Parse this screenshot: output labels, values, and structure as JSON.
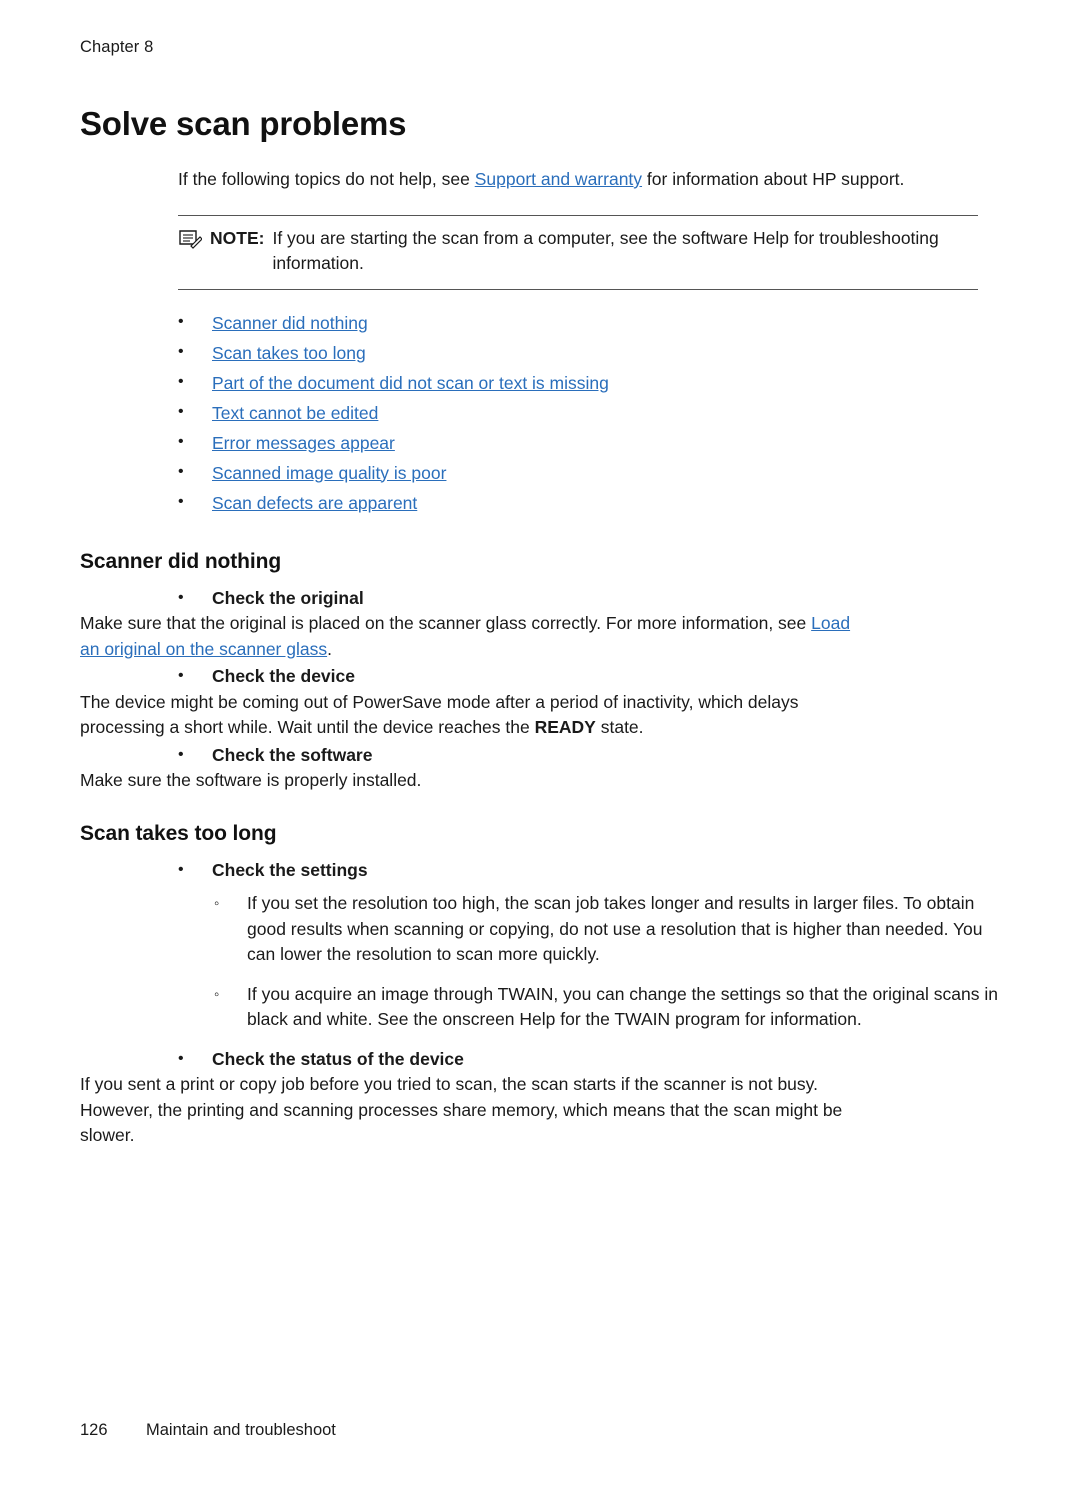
{
  "header": {
    "chapter": "Chapter 8"
  },
  "title": "Solve scan problems",
  "intro": {
    "before_link": "If the following topics do not help, see ",
    "link": "Support and warranty",
    "after_link": " for information about HP support."
  },
  "note": {
    "icon": "note-icon",
    "label": "NOTE:",
    "text": "If you are starting the scan from a computer, see the software Help for troubleshooting information."
  },
  "toc": [
    "Scanner did nothing",
    "Scan takes too long",
    "Part of the document did not scan or text is missing",
    "Text cannot be edited",
    "Error messages appear",
    "Scanned image quality is poor",
    "Scan defects are apparent"
  ],
  "sections": [
    {
      "heading": "Scanner did nothing",
      "items": [
        {
          "bullet": "Check the original",
          "para_before_link": "Make sure that the original is placed on the scanner glass correctly. For more information, see ",
          "para_link": "Load an original on the scanner glass",
          "para_after_link": "."
        },
        {
          "bullet": "Check the device",
          "para_part1": "The device might be coming out of PowerSave mode after a period of inactivity, which delays processing a short while. Wait until the device reaches the ",
          "para_bold": "READY",
          "para_part2": " state."
        },
        {
          "bullet": "Check the software",
          "para": "Make sure the software is properly installed."
        }
      ]
    },
    {
      "heading": "Scan takes too long",
      "items": [
        {
          "bullet": "Check the settings",
          "subbullets": [
            "If you set the resolution too high, the scan job takes longer and results in larger files. To obtain good results when scanning or copying, do not use a resolution that is higher than needed. You can lower the resolution to scan more quickly.",
            "If you acquire an image through TWAIN, you can change the settings so that the original scans in black and white. See the onscreen Help for the TWAIN program for information."
          ]
        },
        {
          "bullet": "Check the status of the device",
          "para": "If you sent a print or copy job before you tried to scan, the scan starts if the scanner is not busy. However, the printing and scanning processes share memory, which means that the scan might be slower."
        }
      ]
    }
  ],
  "footer": {
    "page_number": "126",
    "text": "Maintain and troubleshoot"
  },
  "colors": {
    "link": "#2a6ebb",
    "text": "#1a1a1a"
  }
}
